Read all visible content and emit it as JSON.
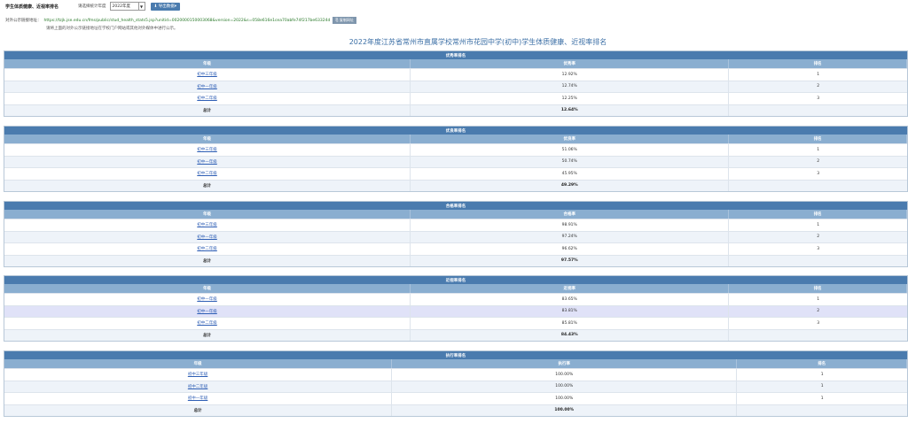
{
  "topbar": {
    "title": "学生体质健康、近视率排名",
    "year_label": "请选择统计年度",
    "year_value": "2022年度",
    "export_label": "⬇ 导出数据▾"
  },
  "urlrow": {
    "label": "对外公示链接地址：",
    "url": "https://tzjk.jse.edu.cn/fms/public/stud_health_stats5.jsp?unitid=0020000150003068&version=2022&s=058e616e1cea70abfe74f217be63324d",
    "copy_label": "⎘ 复制网址",
    "note": "请将上面的对外公示链接地址在学校门户网站或其他对外媒体中进行公示。"
  },
  "page_title": "2022年度江苏省常州市直属学校常州市花园中学(初中)学生体质健康、近视率排名",
  "sections": [
    {
      "title": "优秀率排名",
      "headers": [
        "年级",
        "优秀率",
        "排名"
      ],
      "rows": [
        [
          "初中三年级",
          "12.92%",
          "1"
        ],
        [
          "初中一年级",
          "12.74%",
          "2"
        ],
        [
          "初中二年级",
          "12.25%",
          "3"
        ]
      ],
      "total": [
        "总计",
        "12.64%",
        ""
      ]
    },
    {
      "title": "优良率排名",
      "headers": [
        "年级",
        "优良率",
        "排名"
      ],
      "rows": [
        [
          "初中三年级",
          "51.06%",
          "1"
        ],
        [
          "初中一年级",
          "50.74%",
          "2"
        ],
        [
          "初中二年级",
          "45.95%",
          "3"
        ]
      ],
      "total": [
        "总计",
        "49.29%",
        ""
      ]
    },
    {
      "title": "合格率排名",
      "headers": [
        "年级",
        "合格率",
        "排名"
      ],
      "rows": [
        [
          "初中三年级",
          "98.91%",
          "1"
        ],
        [
          "初中一年级",
          "97.24%",
          "2"
        ],
        [
          "初中二年级",
          "96.62%",
          "3"
        ]
      ],
      "total": [
        "总计",
        "97.57%",
        ""
      ]
    },
    {
      "title": "近视率排名",
      "headers": [
        "年级",
        "近视率",
        "排名"
      ],
      "rows": [
        [
          "初中一年级",
          "83.65%",
          "1"
        ],
        [
          "初中一年级",
          "83.81%",
          "2"
        ],
        [
          "初中二年级",
          "85.81%",
          "3"
        ]
      ],
      "total": [
        "总计",
        "84.43%",
        ""
      ]
    },
    {
      "title": "执行率排名",
      "headers": [
        "年级",
        "执行率",
        "排名"
      ],
      "rows": [
        [
          "初中三年级",
          "100.00%",
          "1"
        ],
        [
          "初中二年级",
          "100.00%",
          "1"
        ],
        [
          "初中一年级",
          "100.00%",
          "1"
        ]
      ],
      "total": [
        "总计",
        "100.00%",
        ""
      ]
    }
  ]
}
